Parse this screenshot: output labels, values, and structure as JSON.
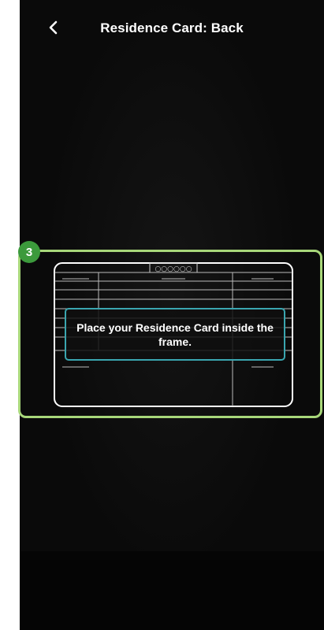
{
  "header": {
    "title": "Residence Card: Back",
    "back_icon": "chevron-left-icon"
  },
  "step": {
    "number": "3",
    "badge_color": "#3c9a3c",
    "highlight_color": "#a8d77a"
  },
  "card_frame": {
    "top_label": "○○○○○○",
    "instruction": "Place your Residence Card inside the frame.",
    "instruction_border_color": "#3aa6b0"
  },
  "colors": {
    "background": "#0a0a0a",
    "text": "#ffffff"
  }
}
